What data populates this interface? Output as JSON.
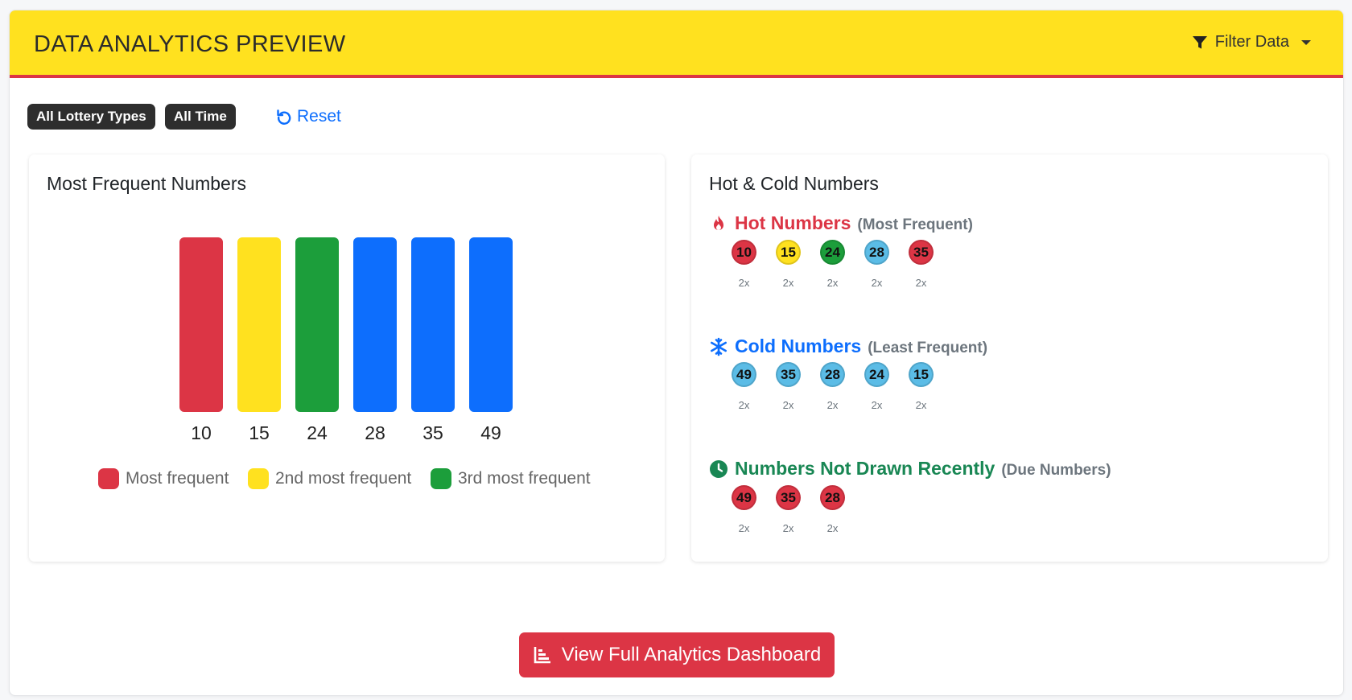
{
  "header": {
    "title": "DATA ANALYTICS PREVIEW",
    "filter_label": "Filter Data"
  },
  "filters": {
    "pills": [
      "All Lottery Types",
      "All Time"
    ],
    "reset_label": "Reset"
  },
  "frequent": {
    "title": "Most Frequent Numbers",
    "legend": [
      "Most frequent",
      "2nd most frequent",
      "3rd most frequent"
    ]
  },
  "chart_data": {
    "type": "bar",
    "title": "Most Frequent Numbers",
    "categories": [
      "10",
      "15",
      "24",
      "28",
      "35",
      "49"
    ],
    "values": [
      2,
      2,
      2,
      2,
      2,
      2
    ],
    "colors": [
      "#dc3545",
      "#ffe11f",
      "#1c9e3b",
      "#0d6efd",
      "#0d6efd",
      "#0d6efd"
    ],
    "ylim": [
      0,
      2
    ],
    "legend": [
      "Most frequent",
      "2nd most frequent",
      "3rd most frequent"
    ],
    "legend_placement": "bottom",
    "grid": false
  },
  "hotcold": {
    "title": "Hot & Cold Numbers",
    "hot": {
      "title": "Hot Numbers",
      "sub": "(Most Frequent)",
      "color": "#dc3545",
      "balls": [
        {
          "n": "10",
          "c": "2x",
          "color": "#dc3545"
        },
        {
          "n": "15",
          "c": "2x",
          "color": "#ffe11f"
        },
        {
          "n": "24",
          "c": "2x",
          "color": "#1c9e3b"
        },
        {
          "n": "28",
          "c": "2x",
          "color": "#5bbce6"
        },
        {
          "n": "35",
          "c": "2x",
          "color": "#dc3545"
        }
      ]
    },
    "cold": {
      "title": "Cold Numbers",
      "sub": "(Least Frequent)",
      "color": "#0d6efd",
      "balls": [
        {
          "n": "49",
          "c": "2x",
          "color": "#5bbce6"
        },
        {
          "n": "35",
          "c": "2x",
          "color": "#5bbce6"
        },
        {
          "n": "28",
          "c": "2x",
          "color": "#5bbce6"
        },
        {
          "n": "24",
          "c": "2x",
          "color": "#5bbce6"
        },
        {
          "n": "15",
          "c": "2x",
          "color": "#5bbce6"
        }
      ]
    },
    "due": {
      "title": "Numbers Not Drawn Recently",
      "sub": "(Due Numbers)",
      "color": "#198754",
      "balls": [
        {
          "n": "49",
          "c": "2x",
          "color": "#dc3545"
        },
        {
          "n": "35",
          "c": "2x",
          "color": "#dc3545"
        },
        {
          "n": "28",
          "c": "2x",
          "color": "#dc3545"
        }
      ]
    }
  },
  "cta": {
    "label": "View Full Analytics Dashboard"
  },
  "icons": {
    "filter": "filter-icon",
    "reset": "reset-icon",
    "hot": "fire-icon",
    "cold": "snowflake-icon",
    "due": "clock-icon",
    "cta": "chart-icon"
  }
}
